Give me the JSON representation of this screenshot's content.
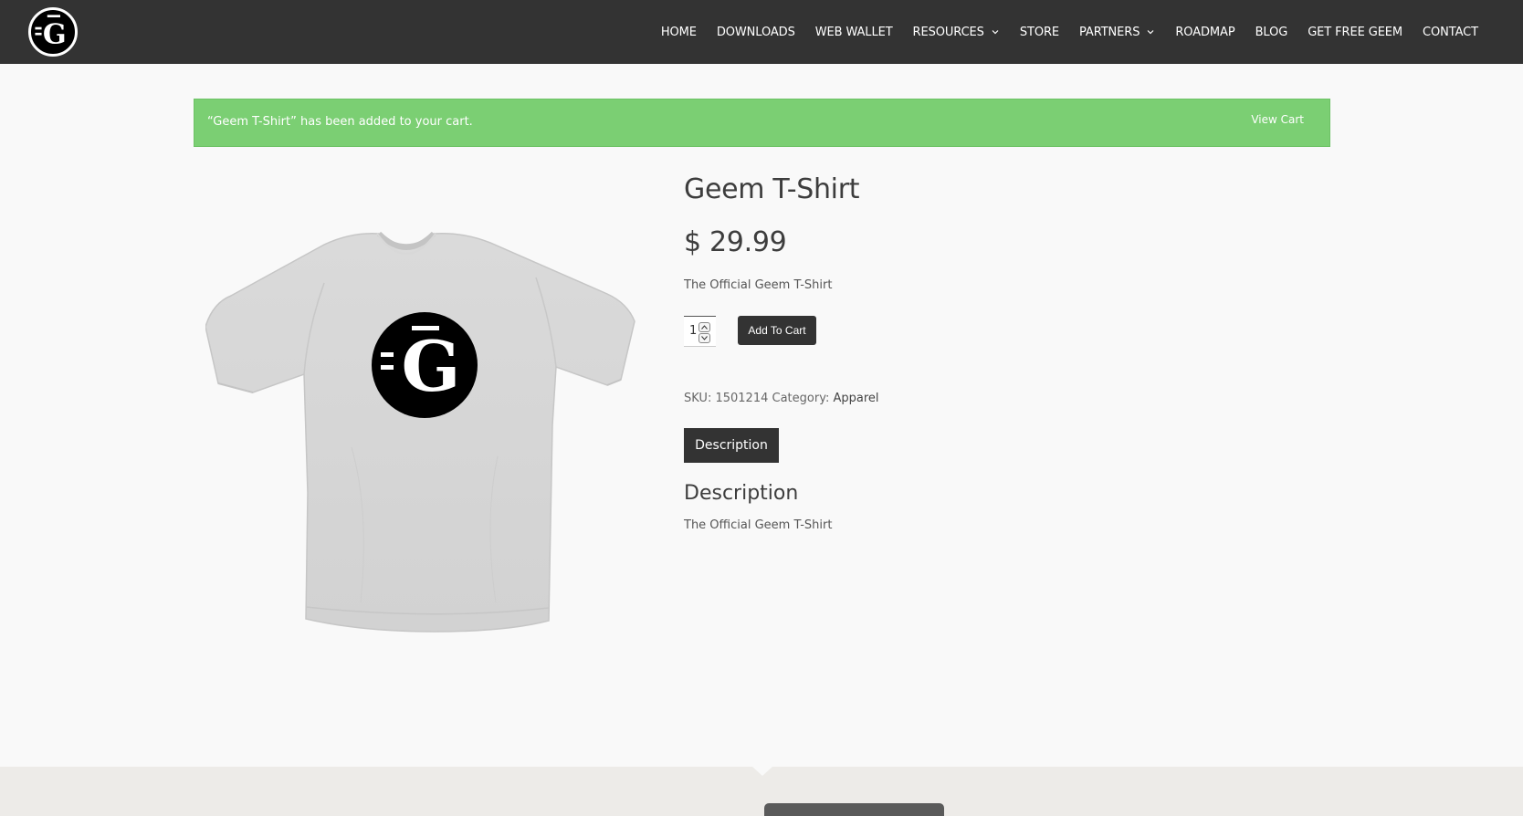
{
  "header": {
    "logo_letter": "G",
    "nav": [
      {
        "label": "HOME",
        "has_dropdown": false
      },
      {
        "label": "DOWNLOADS",
        "has_dropdown": false
      },
      {
        "label": "WEB WALLET",
        "has_dropdown": false
      },
      {
        "label": "RESOURCES",
        "has_dropdown": true
      },
      {
        "label": "STORE",
        "has_dropdown": false
      },
      {
        "label": "PARTNERS",
        "has_dropdown": true
      },
      {
        "label": "ROADMAP",
        "has_dropdown": false
      },
      {
        "label": "BLOG",
        "has_dropdown": false
      },
      {
        "label": "GET FREE GEEM",
        "has_dropdown": false
      },
      {
        "label": "CONTACT",
        "has_dropdown": false
      }
    ]
  },
  "notice": {
    "message": "“Geem T-Shirt” has been added to your cart.",
    "link_label": "View Cart"
  },
  "product": {
    "image_icon": "t-shirt-with-geem-logo",
    "title": "Geem T-Shirt",
    "price": "$ 29.99",
    "short_description": "The Official Geem T-Shirt",
    "quantity": "1",
    "add_to_cart_label": "Add To Cart",
    "sku_label": "SKU:",
    "sku": "1501214",
    "category_label": "Category:",
    "category": "Apparel"
  },
  "tabs": {
    "description_tab": "Description"
  },
  "description": {
    "heading": "Description",
    "text": "The Official Geem T-Shirt"
  },
  "colors": {
    "header_bg": "#333333",
    "notice_bg": "#7bcf73",
    "button_bg": "#333333",
    "page_bg": "#f9f9f9",
    "footer_bg": "#edebe8"
  }
}
